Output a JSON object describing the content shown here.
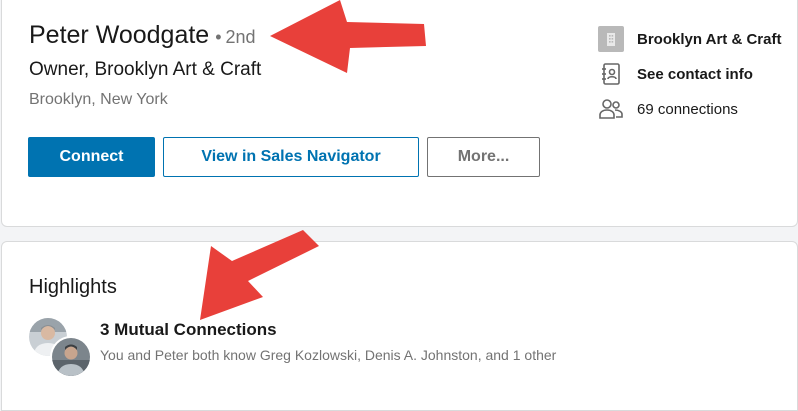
{
  "profile": {
    "name": "Peter Woodgate",
    "degree_separator": "•",
    "degree": "2nd",
    "headline": "Owner, Brooklyn Art & Craft",
    "location": "Brooklyn, New York",
    "actions": {
      "connect_label": "Connect",
      "sales_navigator_label": "View in Sales Navigator",
      "more_label": "More..."
    },
    "sidebar": {
      "company": {
        "icon": "building-icon",
        "label": "Brooklyn Art & Craft"
      },
      "contact": {
        "icon": "contact-card-icon",
        "label": "See contact info"
      },
      "connections": {
        "icon": "people-icon",
        "label": "69 connections"
      }
    }
  },
  "highlights": {
    "title": "Highlights",
    "mutual": {
      "title": "3 Mutual Connections",
      "description": "You and Peter both know Greg Kozlowski, Denis A. Johnston, and 1 other"
    }
  },
  "colors": {
    "primary_blue": "#0073b1",
    "muted_gray": "#737373",
    "annotation_red": "#e8403a"
  }
}
